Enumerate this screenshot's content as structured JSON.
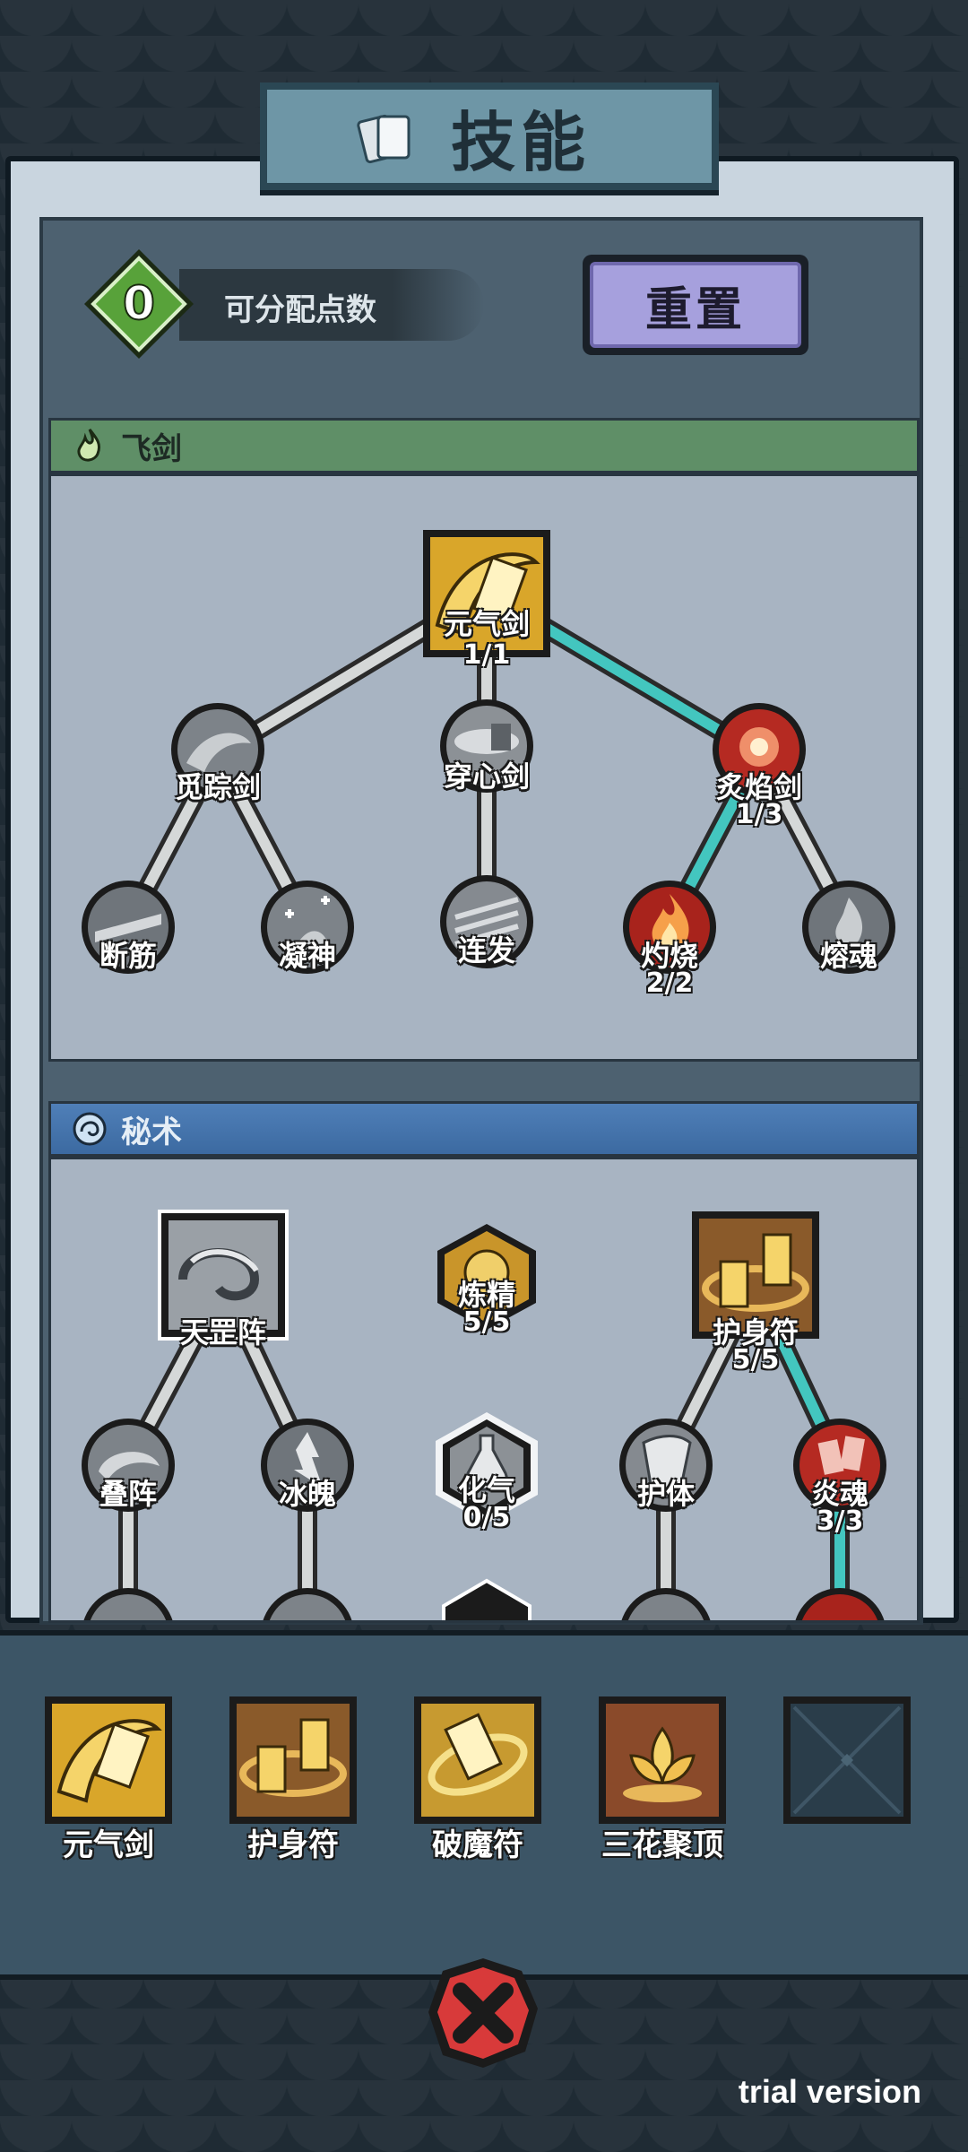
{
  "title": "技能",
  "points": {
    "value": "0",
    "label": "可分配点数"
  },
  "reset_label": "重置",
  "colors": {
    "accent_link": "#43c6bf",
    "inactive_link": "#d5d8d8",
    "points_badge": "#58a23a",
    "reset_button": "#a6a0dd"
  },
  "sections": [
    {
      "label": "飞剑",
      "icon": "green-flame-icon",
      "nodes": [
        {
          "name": "元气剑",
          "level": "1/1",
          "icon": "golden-sword-icon"
        },
        {
          "name": "觅踪剑",
          "level": "",
          "icon": "tracking-sword-icon"
        },
        {
          "name": "穿心剑",
          "level": "",
          "icon": "piercing-sword-icon"
        },
        {
          "name": "炙焰剑",
          "level": "1/3",
          "icon": "flame-sword-icon"
        },
        {
          "name": "断筋",
          "level": "",
          "icon": "tendon-cut-icon"
        },
        {
          "name": "凝神",
          "level": "",
          "icon": "focus-icon"
        },
        {
          "name": "连发",
          "level": "",
          "icon": "burst-icon"
        },
        {
          "name": "灼烧",
          "level": "2/2",
          "icon": "burn-icon"
        },
        {
          "name": "熔魂",
          "level": "",
          "icon": "melt-soul-icon"
        }
      ]
    },
    {
      "label": "秘术",
      "icon": "blue-swirl-icon",
      "nodes": [
        {
          "name": "天罡阵",
          "level": "",
          "icon": "formation-icon"
        },
        {
          "name": "炼精",
          "level": "5/5",
          "icon": "refine-icon"
        },
        {
          "name": "护身符",
          "level": "5/5",
          "icon": "talisman-icon"
        },
        {
          "name": "叠阵",
          "level": "",
          "icon": "stack-formation-icon"
        },
        {
          "name": "冰魄",
          "level": "",
          "icon": "ice-soul-icon"
        },
        {
          "name": "化气",
          "level": "0/5",
          "icon": "transform-qi-icon"
        },
        {
          "name": "护体",
          "level": "",
          "icon": "body-guard-icon"
        },
        {
          "name": "炎魂",
          "level": "3/3",
          "icon": "flame-soul-icon"
        }
      ]
    }
  ],
  "equipped": [
    {
      "name": "元气剑",
      "icon": "golden-sword-icon"
    },
    {
      "name": "护身符",
      "icon": "talisman-icon"
    },
    {
      "name": "破魔符",
      "icon": "demon-break-talisman-icon"
    },
    {
      "name": "三花聚顶",
      "icon": "lotus-icon"
    },
    {
      "name": "",
      "icon": "empty-slot-icon"
    }
  ],
  "close_icon": "close-icon",
  "watermark": "trial version"
}
